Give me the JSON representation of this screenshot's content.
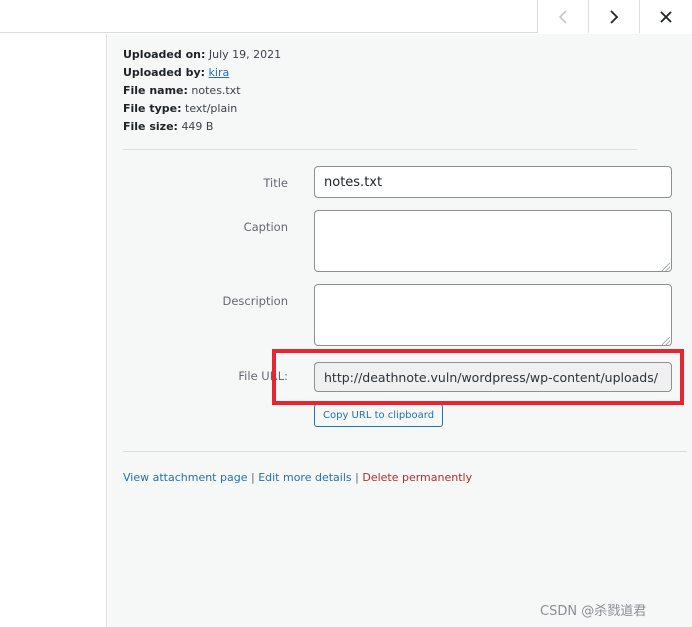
{
  "header": {
    "prev_icon": "chevron-left-icon",
    "next_icon": "chevron-right-icon",
    "close_icon": "close-icon"
  },
  "details": {
    "uploaded_on_label": "Uploaded on:",
    "uploaded_on_value": "July 19, 2021",
    "uploaded_by_label": "Uploaded by:",
    "uploaded_by_value": "kira",
    "file_name_label": "File name:",
    "file_name_value": "notes.txt",
    "file_type_label": "File type:",
    "file_type_value": "text/plain",
    "file_size_label": "File size:",
    "file_size_value": "449 B"
  },
  "form": {
    "title_label": "Title",
    "title_value": "notes.txt",
    "caption_label": "Caption",
    "caption_value": "",
    "description_label": "Description",
    "description_value": "",
    "file_url_label": "File URL:",
    "file_url_value": "http://deathnote.vuln/wordpress/wp-content/uploads/",
    "copy_button": "Copy URL to clipboard"
  },
  "actions": {
    "view_attachment": "View attachment page",
    "separator": "|",
    "edit_details": "Edit more details",
    "delete": "Delete permanently"
  },
  "watermark": "CSDN @杀戮道君",
  "colors": {
    "link": "#2271b1",
    "danger": "#b32d2e",
    "highlight": "#e8242f"
  }
}
